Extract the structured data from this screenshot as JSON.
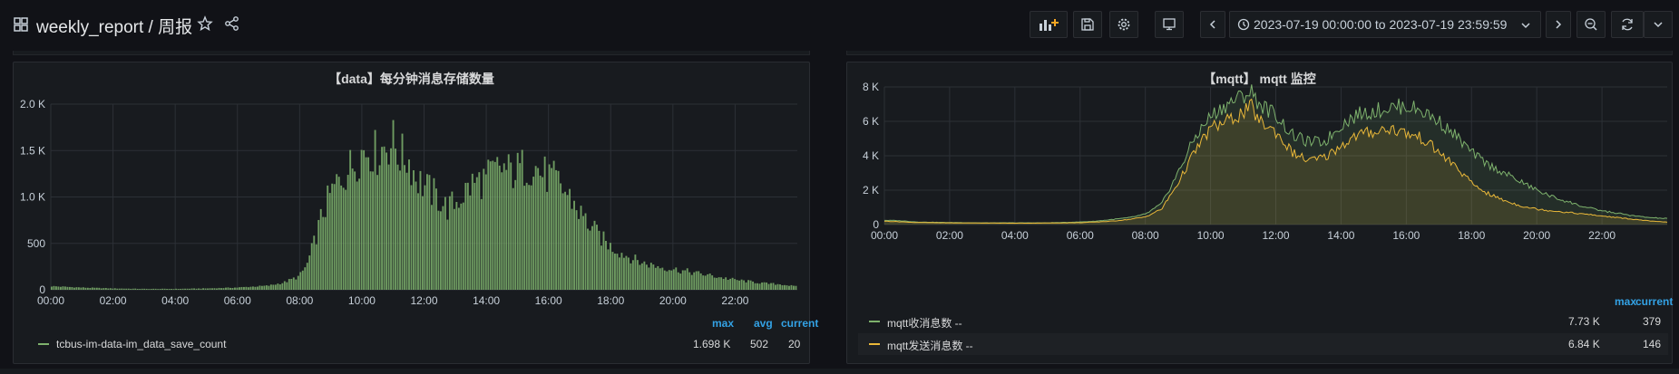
{
  "header": {
    "title": "weekly_report / 周报",
    "time_range": "2023-07-19 00:00:00 to 2023-07-19 23:59:59",
    "icons": [
      "dashboard-grid-icon",
      "star-icon",
      "share-icon",
      "add-panel-icon",
      "save-icon",
      "settings-icon",
      "tv-mode-icon",
      "time-back-icon",
      "clock-icon",
      "chevron-down-icon",
      "time-forward-icon",
      "zoom-out-icon",
      "refresh-icon",
      "chevron-down-icon"
    ]
  },
  "panels": [
    {
      "title": "【data】每分钟消息存储数量",
      "legend_headers": {
        "max": "max",
        "avg": "avg",
        "current": "current"
      },
      "legend": [
        {
          "name": "tcbus-im-data-im_data_save_count",
          "max": "1.698 K",
          "avg": "502",
          "current": "20",
          "color": "#7eb26d"
        }
      ]
    },
    {
      "title": "【mqtt】 mqtt 监控",
      "legend_headers": {
        "max": "max",
        "current": "current"
      },
      "legend": [
        {
          "name": "mqtt收消息数 --",
          "max": "7.73 K",
          "current": "379",
          "color": "#7eb26d"
        },
        {
          "name": "mqtt发送消息数 --",
          "max": "6.84 K",
          "current": "146",
          "color": "#eab839"
        }
      ]
    }
  ],
  "chart_data": [
    {
      "type": "bar",
      "title": "【data】每分钟消息存储数量",
      "x_ticks": [
        "00:00",
        "02:00",
        "04:00",
        "06:00",
        "08:00",
        "10:00",
        "12:00",
        "14:00",
        "16:00",
        "18:00",
        "20:00",
        "22:00"
      ],
      "y_ticks": [
        "0",
        "500",
        "1.0 K",
        "1.5 K",
        "2.0 K"
      ],
      "ylim": [
        0,
        2000
      ],
      "xlim_hours": [
        0,
        24
      ],
      "color": "#7eb26d",
      "series": [
        {
          "name": "tcbus-im-data-im_data_save_count",
          "x": [
            0,
            1,
            2,
            3,
            4,
            5,
            6,
            7,
            7.5,
            8,
            8.25,
            8.5,
            8.75,
            9,
            9.25,
            9.5,
            9.75,
            10,
            10.25,
            10.5,
            10.75,
            11,
            11.25,
            11.5,
            11.75,
            12,
            12.25,
            12.5,
            12.75,
            13,
            13.25,
            13.5,
            13.75,
            14,
            14.25,
            14.5,
            14.75,
            15,
            15.25,
            15.5,
            15.75,
            16,
            16.25,
            16.5,
            16.75,
            17,
            17.25,
            17.5,
            17.75,
            18,
            18.5,
            19,
            19.5,
            20,
            20.5,
            21,
            21.5,
            22,
            22.5,
            23,
            23.5,
            24
          ],
          "y": [
            40,
            25,
            15,
            10,
            10,
            15,
            25,
            45,
            80,
            150,
            280,
            550,
            850,
            1050,
            1200,
            1300,
            1400,
            1520,
            1560,
            1500,
            1600,
            1640,
            1480,
            1450,
            1250,
            1150,
            1080,
            1000,
            900,
            960,
            1050,
            1150,
            1200,
            1220,
            1300,
            1350,
            1300,
            1320,
            1360,
            1380,
            1300,
            1250,
            1200,
            1100,
            1000,
            860,
            750,
            650,
            560,
            480,
            380,
            300,
            260,
            230,
            200,
            170,
            140,
            110,
            90,
            70,
            60,
            35
          ]
        }
      ]
    },
    {
      "type": "area",
      "title": "【mqtt】 mqtt 监控",
      "x_ticks": [
        "00:00",
        "02:00",
        "04:00",
        "06:00",
        "08:00",
        "10:00",
        "12:00",
        "14:00",
        "16:00",
        "18:00",
        "20:00",
        "22:00"
      ],
      "y_ticks": [
        "0",
        "2 K",
        "4 K",
        "6 K",
        "8 K"
      ],
      "ylim": [
        0,
        8000
      ],
      "xlim_hours": [
        0,
        24
      ],
      "series": [
        {
          "name": "mqtt收消息数 --",
          "color": "#7eb26d",
          "x": [
            0,
            0.5,
            1,
            2,
            3,
            4,
            5,
            6,
            6.5,
            7,
            7.5,
            8,
            8.5,
            9,
            9.5,
            10,
            10.5,
            11,
            11.25,
            11.5,
            12,
            12.5,
            13,
            13.5,
            14,
            14.5,
            15,
            15.5,
            16,
            16.5,
            17,
            17.5,
            18,
            18.5,
            19,
            19.5,
            20,
            20.5,
            21,
            21.5,
            22,
            22.5,
            23,
            23.5,
            24
          ],
          "y": [
            250,
            220,
            150,
            120,
            100,
            100,
            100,
            150,
            200,
            300,
            400,
            600,
            1200,
            3000,
            5000,
            6300,
            7000,
            7500,
            7730,
            7000,
            6400,
            5200,
            4800,
            4800,
            5800,
            6400,
            6600,
            6800,
            6900,
            6600,
            6000,
            5200,
            4200,
            3500,
            3000,
            2500,
            2000,
            1600,
            1300,
            1000,
            800,
            650,
            500,
            400,
            350
          ]
        },
        {
          "name": "mqtt发送消息数 --",
          "color": "#eab839",
          "x": [
            0,
            0.5,
            1,
            2,
            3,
            4,
            5,
            6,
            6.5,
            7,
            7.5,
            8,
            8.5,
            9,
            9.5,
            10,
            10.5,
            11,
            11.25,
            11.5,
            12,
            12.5,
            13,
            13.5,
            14,
            14.5,
            15,
            15.5,
            16,
            16.5,
            17,
            17.5,
            18,
            18.5,
            19,
            19.5,
            20,
            20.5,
            21,
            21.5,
            22,
            22.5,
            23,
            23.5,
            24
          ],
          "y": [
            200,
            160,
            120,
            100,
            90,
            80,
            90,
            110,
            150,
            200,
            300,
            450,
            900,
            2400,
            4200,
            5600,
            6000,
            6500,
            6840,
            6000,
            5400,
            4200,
            3700,
            3900,
            4600,
            5200,
            5400,
            5600,
            5300,
            5000,
            4200,
            3400,
            2400,
            1800,
            1400,
            1100,
            900,
            800,
            700,
            600,
            500,
            400,
            300,
            200,
            146
          ]
        }
      ]
    }
  ]
}
